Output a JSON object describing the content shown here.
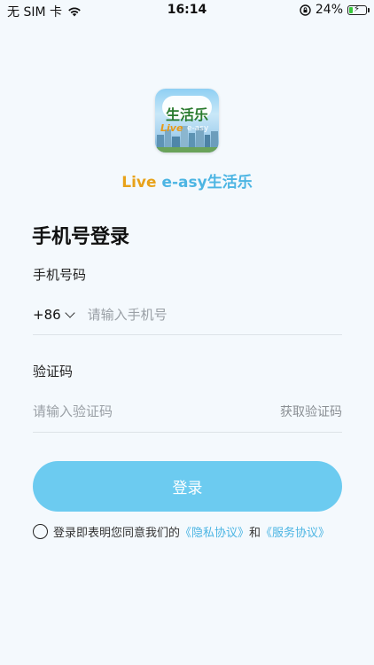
{
  "status_bar": {
    "carrier": "无 SIM 卡",
    "time": "16:14",
    "battery_text": "24%",
    "battery_level": 0.24
  },
  "app": {
    "logo_cn": "生活乐",
    "logo_en": "Live",
    "logo_en2": "e-asy",
    "brand_live": "Live",
    "brand_rest": "e-asy生活乐"
  },
  "login": {
    "title": "手机号登录",
    "phone_label": "手机号码",
    "country_code": "+86",
    "phone_placeholder": "请输入手机号",
    "code_label": "验证码",
    "code_placeholder": "请输入验证码",
    "get_code": "获取验证码",
    "submit": "登录"
  },
  "agreement": {
    "prefix": "登录即表明您同意我们的",
    "privacy": "《隐私协议》",
    "and": "和",
    "service": "《服务协议》"
  },
  "colors": {
    "accent": "#6ccbf0",
    "link": "#4cb5e3",
    "brand_orange": "#e8a21a"
  }
}
